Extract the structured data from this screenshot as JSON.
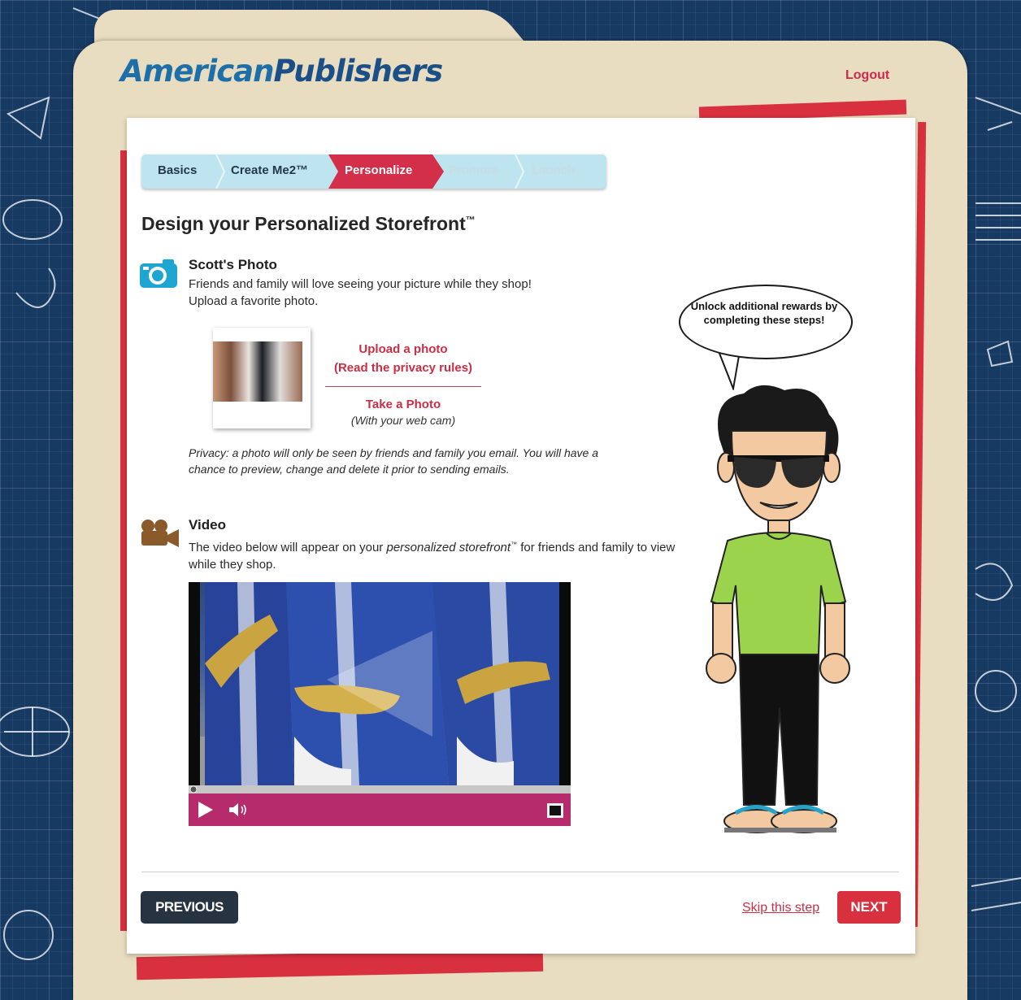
{
  "header": {
    "logo_part1": "American",
    "logo_part2": "Publishers",
    "logout_label": "Logout"
  },
  "steps": [
    {
      "label": "Basics",
      "state": "done"
    },
    {
      "label": "Create Me2™",
      "state": "done"
    },
    {
      "label": "Personalize",
      "state": "active"
    },
    {
      "label": "Promote",
      "state": "pending"
    },
    {
      "label": "Launch",
      "state": "pending"
    }
  ],
  "page": {
    "title": "Design your Personalized Storefront",
    "title_mark": "™"
  },
  "photo_section": {
    "heading": "Scott's Photo",
    "line1": "Friends and family will love seeing your picture while they shop!",
    "line2": "Upload a favorite photo.",
    "upload_label": "Upload a photo",
    "privacy_rules_label": "(Read the privacy rules)",
    "take_photo_label": "Take a Photo",
    "webcam_note": "(With your web cam)",
    "privacy_note": "Privacy: a photo will only be seen by friends and family you email. You will have a chance to preview, change and delete it prior to sending emails."
  },
  "video_section": {
    "heading": "Video",
    "text_before": "The video below will appear on your ",
    "text_italic": "personalized storefront",
    "text_mark": "™",
    "text_after": " for friends and family to view while they shop.",
    "progress": 0
  },
  "bubble": {
    "text": "Unlock additional rewards by completing these steps!"
  },
  "footer": {
    "previous_label": "PREVIOUS",
    "skip_label": "Skip this step",
    "next_label": "NEXT"
  },
  "colors": {
    "brand_red": "#d8303f",
    "logo_blue": "#1c6fa8",
    "step_bar": "#bde4ef",
    "video_controls": "#b52b6b",
    "blueprint": "#173a63"
  },
  "icons": [
    "camera-icon",
    "video-camera-icon",
    "play-icon",
    "volume-icon",
    "fullscreen-icon"
  ]
}
